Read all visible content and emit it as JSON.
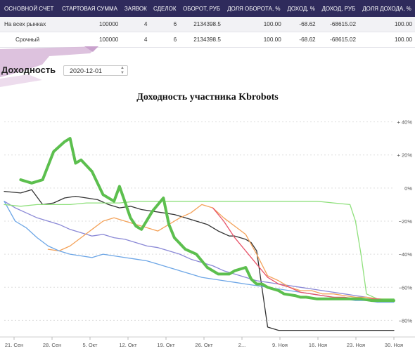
{
  "table": {
    "headers": [
      "ОСНОВНОЙ СЧЕТ",
      "СТАРТОВАЯ СУММА",
      "ЗАЯВОК",
      "СДЕЛОК",
      "ОБОРОТ, РУБ",
      "ДОЛЯ ОБОРОТА, %",
      "ДОХОД, %",
      "ДОХОД, РУБ",
      "ДОЛЯ ДОХОДА, %"
    ],
    "rows": [
      [
        "На всех рынках",
        "100000",
        "4",
        "6",
        "2134398.5",
        "100.00",
        "-68.62",
        "-68615.02",
        "100.00"
      ],
      [
        "Срочный",
        "100000",
        "4",
        "6",
        "2134398.5",
        "100.00",
        "-68.62",
        "-68615.02",
        "100.00"
      ]
    ]
  },
  "section": {
    "title": "Доходность",
    "date_value": "2020-12-01"
  },
  "chart_data": {
    "type": "line",
    "title": "Доходность участника Kbrobots",
    "x_ticks": [
      "21. Сен",
      "28. Сен",
      "5. Окт",
      "12. Окт",
      "19. Окт",
      "26. Окт",
      "2...",
      "9. Ноя",
      "16. Ноя",
      "23. Ноя",
      "30. Ноя"
    ],
    "y_ticks": [
      "+ 40%",
      "+ 20%",
      "0%",
      "−20%",
      "−40%",
      "−60%",
      "−80%"
    ],
    "y_values": [
      40,
      20,
      0,
      -20,
      -40,
      -60,
      -80
    ],
    "ylim": [
      -90,
      50
    ],
    "x_range": [
      0,
      71
    ],
    "colors": {
      "main": "#5cbf4e",
      "dark": "#333333",
      "purple": "#8a88d6",
      "orange": "#f4a259",
      "blue": "#6da6e6",
      "lightgreen": "#8fe07c",
      "red": "#e8546a"
    },
    "series": [
      {
        "color": "#5cbf4e",
        "width": 4,
        "x": [
          3,
          5,
          7,
          9,
          11,
          12,
          13,
          14,
          16,
          18,
          20,
          21,
          23,
          24,
          25,
          27,
          29,
          30,
          31,
          33,
          35,
          37,
          39,
          41,
          42,
          44,
          45,
          46,
          47,
          48,
          50,
          51,
          53,
          54,
          55,
          57,
          59,
          61,
          63,
          65,
          67,
          69,
          71
        ],
        "y": [
          5,
          3,
          5,
          22,
          28,
          30,
          15,
          17,
          10,
          -4,
          -8,
          1,
          -18,
          -23,
          -25,
          -14,
          -6,
          -22,
          -30,
          -37,
          -40,
          -48,
          -52,
          -52,
          -50,
          -48,
          -55,
          -58,
          -58,
          -60,
          -62,
          -64,
          -65,
          -66,
          -66,
          -67,
          -67,
          -67,
          -67,
          -67,
          -68,
          -68,
          -68
        ]
      },
      {
        "color": "#333333",
        "width": 1.3,
        "x": [
          0,
          3,
          5,
          7,
          9,
          11,
          13,
          15,
          17,
          19,
          21,
          23,
          25,
          27,
          29,
          31,
          33,
          35,
          37,
          39,
          41,
          42,
          44,
          45,
          46,
          48,
          50,
          51,
          53,
          55,
          57,
          59,
          61,
          63,
          65,
          67,
          69,
          71
        ],
        "y": [
          -2,
          -3,
          -1,
          -10,
          -9,
          -6,
          -5,
          -6,
          -7,
          -10,
          -12,
          -11,
          -13,
          -14,
          -15,
          -16,
          -18,
          -20,
          -22,
          -26,
          -29,
          -29,
          -31,
          -33,
          -38,
          -84,
          -86,
          -86,
          -86,
          -86,
          -86,
          -86,
          -86,
          -86,
          -86,
          -86,
          -86,
          -86
        ]
      },
      {
        "color": "#8a88d6",
        "width": 1.3,
        "x": [
          0,
          2,
          4,
          6,
          8,
          10,
          12,
          14,
          16,
          18,
          20,
          22,
          24,
          26,
          28,
          30,
          32,
          34,
          36,
          38,
          40,
          42,
          44,
          46,
          48,
          50,
          52,
          54,
          56,
          58,
          60,
          62,
          64,
          66,
          68,
          70,
          71
        ],
        "y": [
          -8,
          -12,
          -15,
          -18,
          -20,
          -22,
          -25,
          -27,
          -29,
          -28,
          -30,
          -31,
          -33,
          -35,
          -36,
          -38,
          -40,
          -43,
          -45,
          -47,
          -50,
          -52,
          -54,
          -56,
          -57,
          -58,
          -59,
          -60,
          -61,
          -62,
          -63,
          -64,
          -65,
          -66,
          -67,
          -67,
          -67
        ]
      },
      {
        "color": "#f4a259",
        "width": 1.3,
        "x": [
          8,
          10,
          12,
          14,
          16,
          18,
          20,
          22,
          24,
          26,
          28,
          30,
          32,
          34,
          36,
          38,
          40,
          42,
          44,
          46,
          48,
          50,
          52,
          54,
          56,
          58,
          60,
          62,
          64,
          66,
          68,
          70
        ],
        "y": [
          -37,
          -38,
          -35,
          -30,
          -25,
          -20,
          -18,
          -20,
          -22,
          -24,
          -26,
          -22,
          -18,
          -15,
          -10,
          -12,
          -18,
          -23,
          -28,
          -40,
          -53,
          -56,
          -60,
          -62,
          -62,
          -64,
          -64,
          -65,
          -66,
          -66,
          -67,
          -67
        ]
      },
      {
        "color": "#6da6e6",
        "width": 1.3,
        "x": [
          0,
          2,
          4,
          6,
          8,
          10,
          12,
          14,
          16,
          18,
          20,
          22,
          24,
          26,
          28,
          30,
          32,
          34,
          36,
          38,
          40,
          42,
          44,
          46,
          48,
          50,
          52,
          54,
          56,
          58,
          60,
          62,
          64,
          66,
          68,
          70,
          71
        ],
        "y": [
          -8,
          -20,
          -24,
          -30,
          -35,
          -38,
          -40,
          -41,
          -42,
          -40,
          -41,
          -42,
          -43,
          -44,
          -46,
          -48,
          -50,
          -52,
          -54,
          -55,
          -56,
          -57,
          -58,
          -59,
          -60,
          -61,
          -62,
          -63,
          -64,
          -65,
          -66,
          -67,
          -68,
          -68,
          -69,
          -69,
          -69
        ]
      },
      {
        "color": "#8fe07c",
        "width": 1.3,
        "x": [
          0,
          3,
          6,
          9,
          12,
          15,
          18,
          21,
          24,
          27,
          30,
          33,
          36,
          39,
          42,
          45,
          48,
          51,
          54,
          57,
          60,
          63,
          64,
          65,
          66,
          68,
          70,
          71
        ],
        "y": [
          -10,
          -11,
          -10,
          -10,
          -10,
          -9,
          -9,
          -9,
          -8,
          -8,
          -8,
          -8,
          -8,
          -8,
          -8,
          -8,
          -8,
          -8,
          -8,
          -8,
          -9,
          -10,
          -20,
          -40,
          -64,
          -67,
          -67,
          -67
        ]
      },
      {
        "color": "#e8546a",
        "width": 1.3,
        "x": [
          38,
          40,
          42,
          44,
          46,
          48,
          50,
          52,
          54,
          56,
          58,
          60,
          62,
          64,
          66,
          68,
          70,
          71
        ],
        "y": [
          -12,
          -20,
          -30,
          -38,
          -46,
          -54,
          -58,
          -60,
          -63,
          -64,
          -65,
          -66,
          -66,
          -67,
          -67,
          -67,
          -68,
          -68
        ]
      }
    ]
  }
}
